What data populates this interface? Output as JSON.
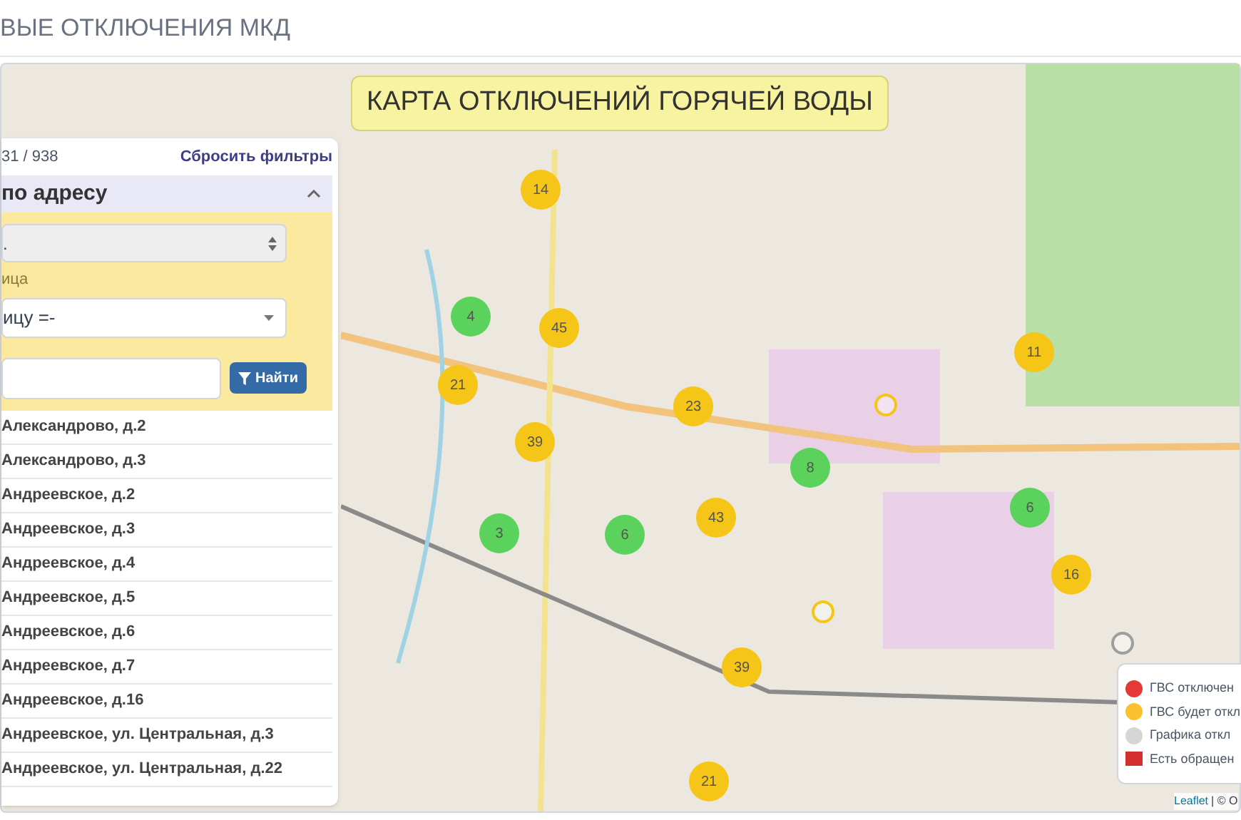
{
  "page_title": "ВЫЕ ОТКЛЮЧЕНИЯ МКД",
  "map": {
    "banner": "КАРТА ОТКЛЮЧЕНИЙ ГОРЯЧЕЙ ВОДЫ",
    "markers": [
      {
        "count": "14",
        "color": "#f5c518"
      },
      {
        "count": "4",
        "color": "#5bd25b"
      },
      {
        "count": "45",
        "color": "#f5c518"
      },
      {
        "count": "21",
        "color": "#f5c518"
      },
      {
        "count": "23",
        "color": "#f5c518"
      },
      {
        "count": "39",
        "color": "#f5c518"
      },
      {
        "count": "8",
        "color": "#5bd25b"
      },
      {
        "count": "43",
        "color": "#f5c518"
      },
      {
        "count": "3",
        "color": "#5bd25b"
      },
      {
        "count": "6",
        "color": "#5bd25b"
      },
      {
        "count": "6",
        "color": "#5bd25b"
      },
      {
        "count": "11",
        "color": "#f5c518"
      },
      {
        "count": "16",
        "color": "#f5c518"
      },
      {
        "count": "39",
        "color": "#f5c518"
      },
      {
        "count": "21",
        "color": "#f5c518"
      }
    ],
    "points": [
      {
        "color": "#f5c518"
      },
      {
        "color": "#f5c518"
      },
      {
        "color": "#9e9e9e"
      }
    ],
    "legend": [
      {
        "kind": "dot",
        "color": "#e53935",
        "label": "ГВС отключен"
      },
      {
        "kind": "dot",
        "color": "#fbc02d",
        "label": "ГВС будет откл"
      },
      {
        "kind": "dot",
        "color": "#d6d6d6",
        "label": "Графика откл"
      },
      {
        "kind": "flag",
        "color": "#d32f2f",
        "label": "Есть обращен"
      }
    ],
    "attribution": {
      "link": "Leaflet",
      "text": "| © O"
    }
  },
  "panel": {
    "count": "31 / 938",
    "reset_link": "Сбросить фильтры",
    "section": {
      "title": "по адресу",
      "expanded": true
    },
    "select_1": {
      "value": "."
    },
    "label_2": "ица",
    "select_2": {
      "value": "ицу =-"
    },
    "find_button": "Найти",
    "results": [
      "Александрово, д.2",
      "Александрово, д.3",
      "Андреевское, д.2",
      "Андреевское, д.3",
      "Андреевское, д.4",
      "Андреевское, д.5",
      "Андреевское, д.6",
      "Андреевское, д.7",
      "Андреевское, д.16",
      "Андреевское, ул. Центральная, д.3",
      "Андреевское, ул. Центральная, д.22"
    ]
  }
}
